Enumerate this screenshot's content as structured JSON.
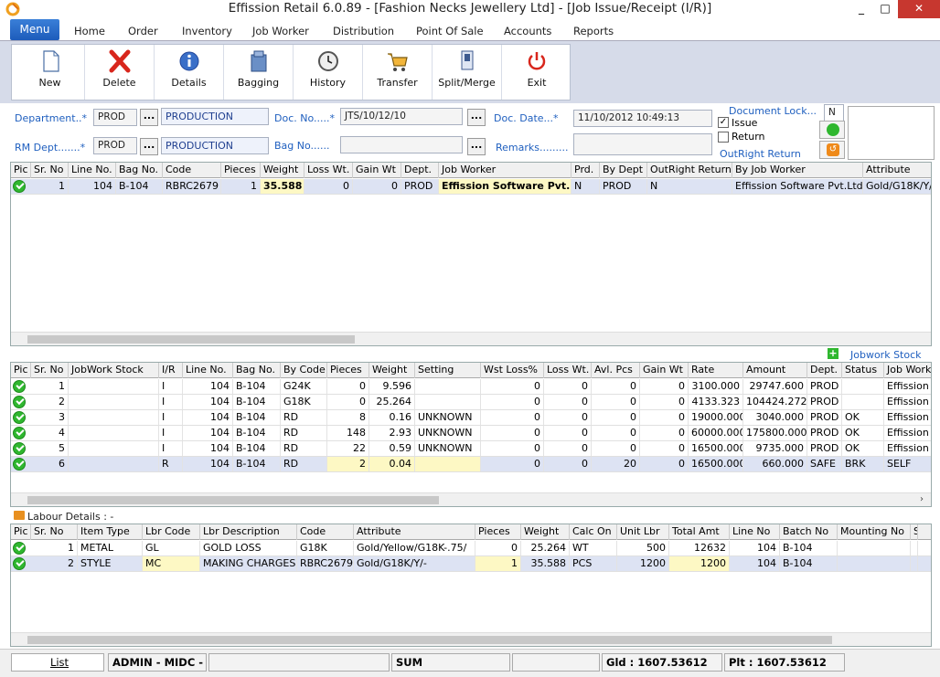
{
  "window": {
    "title": "Effission Retail 6.0.89 - [Fashion Necks Jewellery Ltd] - [Job Issue/Receipt (I/R)]",
    "min": "_",
    "max": "□",
    "close": "✕"
  },
  "menu": {
    "active": "Menu",
    "items": [
      "Home",
      "Order",
      "Inventory",
      "Job Worker",
      "Distribution",
      "Point Of Sale",
      "Accounts",
      "Reports"
    ]
  },
  "toolbar": {
    "buttons": [
      "New",
      "Delete",
      "Details",
      "Bagging",
      "History",
      "Transfer",
      "Split/Merge",
      "Exit"
    ]
  },
  "form": {
    "dept_label": "Department..*",
    "dept_code": "PROD",
    "dept_name": "PRODUCTION",
    "rmdept_label": "RM Dept.......*",
    "rmdept_code": "PROD",
    "rmdept_name": "PRODUCTION",
    "docno_label": "Doc. No.....*",
    "docno": "JTS/10/12/10",
    "bagno_label": "Bag No......",
    "bagno": "",
    "docdate_label": "Doc. Date...*",
    "docdate": "11/10/2012 10:49:13",
    "remarks_label": "Remarks.........",
    "remarks": "",
    "doclock_label": "Document Lock...",
    "doclock": "N",
    "issue_label": "Issue",
    "return_label": "Return",
    "outright_label": "OutRight Return",
    "browse": "..."
  },
  "grid1": {
    "headers": [
      "Pic",
      "Sr. No",
      "Line No.",
      "Bag No.",
      "Code",
      "Pieces",
      "Weight",
      "Loss Wt.",
      "Gain Wt",
      "Dept.",
      "Job Worker",
      "Prd.",
      "By Dept",
      "OutRight Return",
      "By Job Worker",
      "Attribute"
    ],
    "rows": [
      [
        "",
        "1",
        "104",
        "B-104",
        "RBRC2679",
        "1",
        "35.588",
        "0",
        "0",
        "PROD",
        "Effission Software Pvt.Ltd",
        "N",
        "PROD",
        "N",
        "Effission Software Pvt.Ltd",
        "Gold/G18K/Y/"
      ]
    ]
  },
  "jobwork_stock_label": "Jobwork Stock",
  "grid2": {
    "headers": [
      "Pic",
      "Sr. No",
      "JobWork Stock",
      "I/R",
      "Line No.",
      "Bag No.",
      "By Code",
      "Pieces",
      "Weight",
      "Setting",
      "Wst Loss%",
      "Loss Wt.",
      "Avl. Pcs",
      "Gain Wt",
      "Rate",
      "Amount",
      "Dept.",
      "Status",
      "Job Worker"
    ],
    "rows": [
      [
        "",
        "1",
        "",
        "I",
        "104",
        "B-104",
        "G24K",
        "0",
        "9.596",
        "",
        "0",
        "0",
        "0",
        "0",
        "3100.000",
        "29747.600",
        "PROD",
        "",
        "Effission"
      ],
      [
        "",
        "2",
        "",
        "I",
        "104",
        "B-104",
        "G18K",
        "0",
        "25.264",
        "",
        "0",
        "0",
        "0",
        "0",
        "4133.323",
        "104424.272",
        "PROD",
        "",
        "Effission"
      ],
      [
        "",
        "3",
        "",
        "I",
        "104",
        "B-104",
        "RD",
        "8",
        "0.16",
        "UNKNOWN",
        "0",
        "0",
        "0",
        "0",
        "19000.000",
        "3040.000",
        "PROD",
        "OK",
        "Effission"
      ],
      [
        "",
        "4",
        "",
        "I",
        "104",
        "B-104",
        "RD",
        "148",
        "2.93",
        "UNKNOWN",
        "0",
        "0",
        "0",
        "0",
        "60000.000",
        "175800.000",
        "PROD",
        "OK",
        "Effission"
      ],
      [
        "",
        "5",
        "",
        "I",
        "104",
        "B-104",
        "RD",
        "22",
        "0.59",
        "UNKNOWN",
        "0",
        "0",
        "0",
        "0",
        "16500.000",
        "9735.000",
        "PROD",
        "OK",
        "Effission"
      ],
      [
        "",
        "6",
        "",
        "R",
        "104",
        "B-104",
        "RD",
        "2",
        "0.04",
        "",
        "0",
        "0",
        "20",
        "0",
        "16500.000",
        "660.000",
        "SAFE",
        "BRK",
        "SELF"
      ]
    ]
  },
  "labour_label": "Labour Details : -",
  "grid3": {
    "headers": [
      "Pic",
      "Sr. No",
      "Item Type",
      "Lbr Code",
      "Lbr Description",
      "Code",
      "Attribute",
      "Pieces",
      "Weight",
      "Calc On",
      "Unit Lbr",
      "Total Amt",
      "Line No",
      "Batch No",
      "Mounting No",
      "Sla"
    ],
    "rows": [
      [
        "",
        "1",
        "METAL",
        "GL",
        "GOLD LOSS",
        "G18K",
        "Gold/Yellow/G18K-.75/",
        "0",
        "25.264",
        "WT",
        "500",
        "12632",
        "104",
        "B-104",
        "",
        ""
      ],
      [
        "",
        "2",
        "STYLE",
        "MC",
        "MAKING CHARGES",
        "RBRC2679",
        "Gold/G18K/Y/-",
        "1",
        "35.588",
        "PCS",
        "1200",
        "1200",
        "104",
        "B-104",
        "",
        ""
      ]
    ]
  },
  "status": {
    "list": "List",
    "user": "ADMIN - MIDC -",
    "sum": "SUM",
    "gld": "Gld :   1607.53612",
    "plt": "Plt :    1607.53612"
  }
}
